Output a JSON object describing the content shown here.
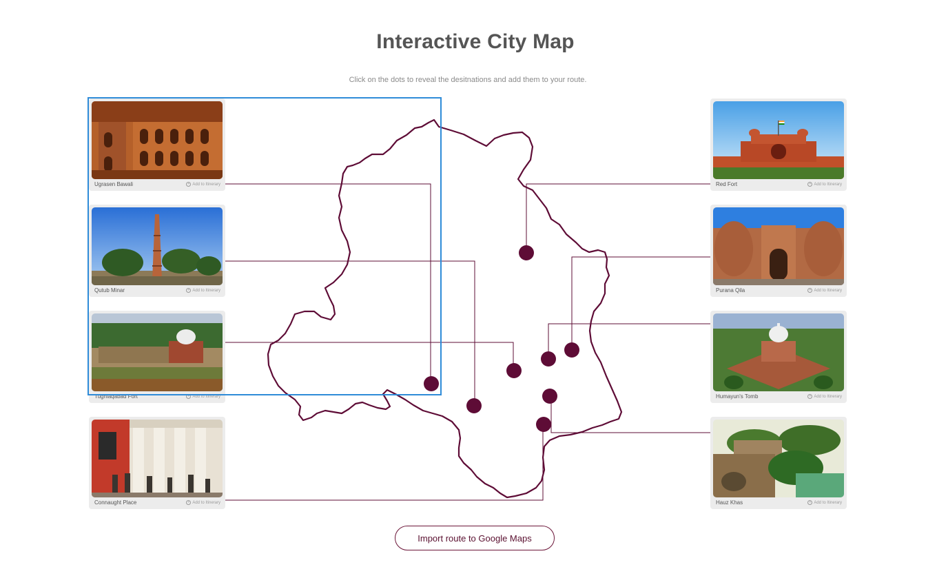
{
  "header": {
    "title": "Interactive City Map",
    "subtitle": "Click on the dots to reveal the desitnations and add them to your route."
  },
  "theme": {
    "accent": "#5e0c36",
    "selection": "#2e8bd8",
    "card_bg": "#ececec"
  },
  "add_label": "Add to Itinerary",
  "destinations_left": [
    {
      "name": "Ugrasen Bawali"
    },
    {
      "name": "Qutub Minar"
    },
    {
      "name": "Tughlaqabad Fort"
    },
    {
      "name": "Connaught Place"
    }
  ],
  "destinations_right": [
    {
      "name": "Red Fort"
    },
    {
      "name": "Purana Qila"
    },
    {
      "name": "Humayun's Tomb"
    },
    {
      "name": "Hauz Khas"
    }
  ],
  "footer": {
    "import_button": "Import route to Google Maps"
  }
}
